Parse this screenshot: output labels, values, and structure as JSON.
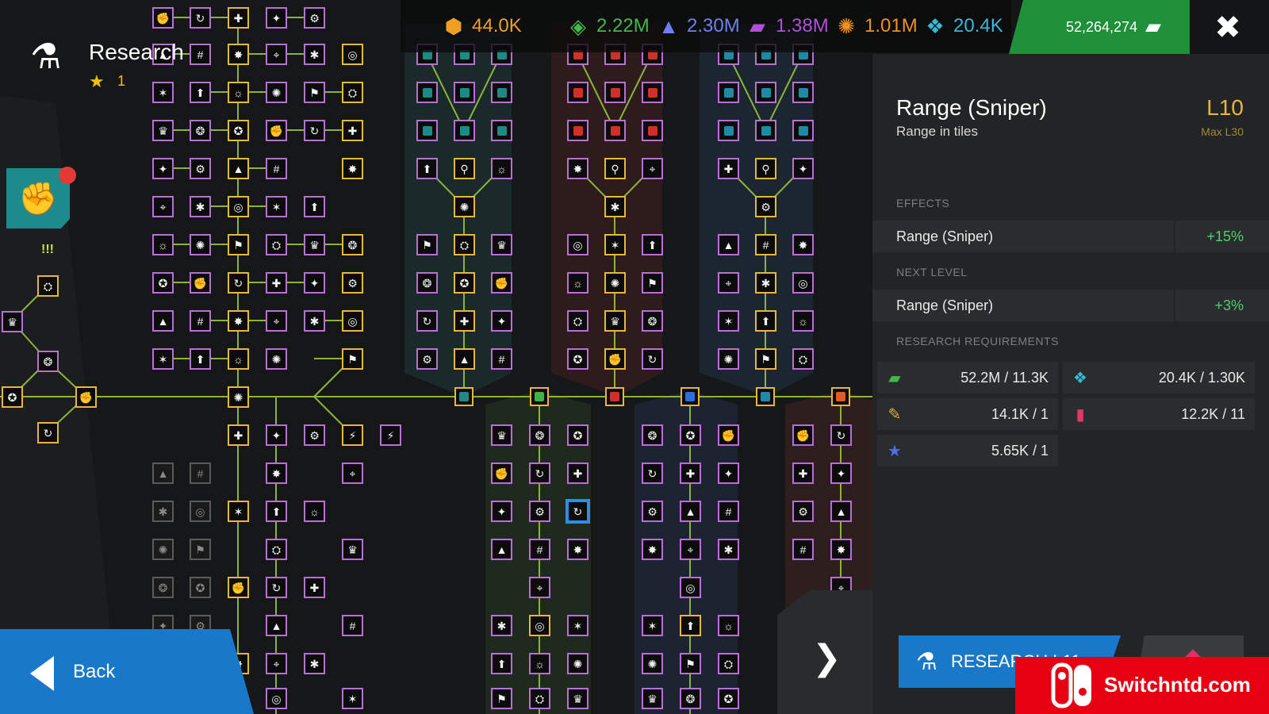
{
  "header": {
    "title": "Research",
    "star_count": "1",
    "alert_text": "!!!"
  },
  "resources": [
    {
      "name": "cells",
      "value": "44.0K",
      "color": "#f0a020",
      "icon": "cell-icon"
    },
    {
      "name": "common-material",
      "value": "2.22M",
      "color": "#41b84a",
      "icon": "leaf-icon"
    },
    {
      "name": "blue-material",
      "value": "2.30M",
      "color": "#6f7ff0",
      "icon": "triangles-icon"
    },
    {
      "name": "purple-material",
      "value": "1.38M",
      "color": "#b050d8",
      "icon": "stripes-icon"
    },
    {
      "name": "orange-material",
      "value": "1.01M",
      "color": "#f09020",
      "icon": "swirl-icon"
    },
    {
      "name": "cyan-material",
      "value": "20.4K",
      "color": "#38b8d8",
      "icon": "crystal-icon"
    }
  ],
  "cash": {
    "value": "52,264,274",
    "icon": "cash-icon"
  },
  "nav": {
    "back_label": "Back"
  },
  "detail": {
    "title": "Range (Sniper)",
    "subtitle": "Range in tiles",
    "level": "L10",
    "max_level": "Max L30",
    "effects_header": "EFFECTS",
    "effect": {
      "label": "Range (Sniper)",
      "value": "+15%"
    },
    "next_header": "NEXT LEVEL",
    "next": {
      "label": "Range (Sniper)",
      "value": "+3%"
    },
    "req_header": "RESEARCH REQUIREMENTS",
    "requirements": [
      {
        "icon": "cash-icon",
        "color": "#41b84a",
        "text": "52.2M / 11.3K"
      },
      {
        "icon": "crystal-icon",
        "color": "#38b8d8",
        "text": "20.4K / 1.30K"
      },
      {
        "icon": "scope-icon",
        "color": "#d8b040",
        "text": "14.1K / 1"
      },
      {
        "icon": "card-icon",
        "color": "#e03a6a",
        "text": "12.2K / 11"
      },
      {
        "icon": "star-card-icon",
        "color": "#4a70e8",
        "text": "5.65K / 1"
      }
    ],
    "research_button": "RESEARCH L11"
  },
  "watermark": {
    "text": "Switchntd.com"
  }
}
